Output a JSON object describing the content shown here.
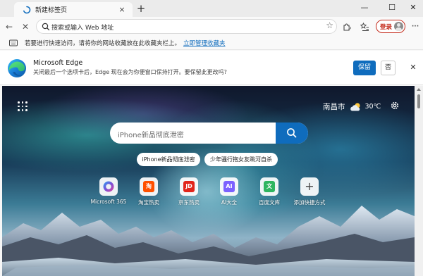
{
  "browser": {
    "tab": {
      "title": "新建标签页",
      "close_glyph": "×",
      "icon": "edge-loading-icon"
    },
    "new_tab_glyph": "+",
    "window": {
      "minimize": "—",
      "maximize": "☐",
      "close": "✕"
    },
    "toolbar": {
      "back_glyph": "←",
      "stop_glyph": "✕",
      "address_placeholder": "搜索或输入 Web 地址",
      "favorite_star": "☆",
      "login_label": "登录",
      "more_glyph": "···"
    }
  },
  "favorites_bar": {
    "text": "若要进行快速访问，请将你的网站收藏放在此收藏夹栏上。",
    "link": "立即管理收藏夹"
  },
  "infobar": {
    "title": "Microsoft Edge",
    "description": "关闭最后一个选项卡后，Edge 现在会为你便窗口保持打开。要保留此更改吗?",
    "keep_label": "保留",
    "no_label": "否",
    "close_glyph": "✕"
  },
  "ntp": {
    "weather": {
      "city": "南昌市",
      "temperature": "30℃",
      "icon": "partly-cloudy-icon"
    },
    "search": {
      "placeholder": "iPhone新品彻底泄密"
    },
    "trending_chips": [
      "iPhone新品彻底泄密",
      "少年骚行抱女友跳河自杀"
    ],
    "quick_links": [
      {
        "label": "Microsoft 365",
        "icon": "microsoft-365-icon",
        "color": "#7b4fd6"
      },
      {
        "label": "淘宝热卖",
        "icon": "taobao-icon",
        "glyph": "淘",
        "color": "#ff5000"
      },
      {
        "label": "京东热卖",
        "icon": "jd-icon",
        "glyph": "JD",
        "color": "#e1251b"
      },
      {
        "label": "AI大全",
        "icon": "ai-icon",
        "glyph": "AI",
        "color": "#7b61ff"
      },
      {
        "label": "百度文库",
        "icon": "baidu-wenku-icon",
        "glyph": "文",
        "color": "#2fb560"
      },
      {
        "label": "添加快捷方式",
        "icon": "add-shortcut-icon",
        "glyph": "+",
        "color": "#444444"
      }
    ]
  },
  "colors": {
    "accent": "#0f6cbd",
    "login_red": "#c42b1c"
  }
}
